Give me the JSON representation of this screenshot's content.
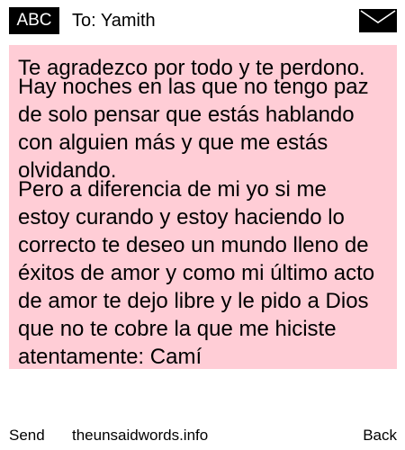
{
  "header": {
    "badge_label": "ABC",
    "to_label": "To: Yamith",
    "envelope_icon": "envelope-icon"
  },
  "message": {
    "background_color": "#ffcdd6",
    "paragraphs": [
      "Te agradezco por todo y te perdono.",
      "Hay noches en las que no tengo paz de solo pensar que estás hablando con alguien más y que me estás olvidando.",
      "Pero a diferencia de mi yo si me estoy curando y estoy haciendo lo correcto te deseo un mundo lleno de éxitos de amor y como mi último acto de amor te dejo libre y le pido a Dios que no te cobre la que me hiciste atentamente: Camí"
    ]
  },
  "footer": {
    "send_label": "Send",
    "site_label": "theunsaidwords.info",
    "back_label": "Back"
  }
}
